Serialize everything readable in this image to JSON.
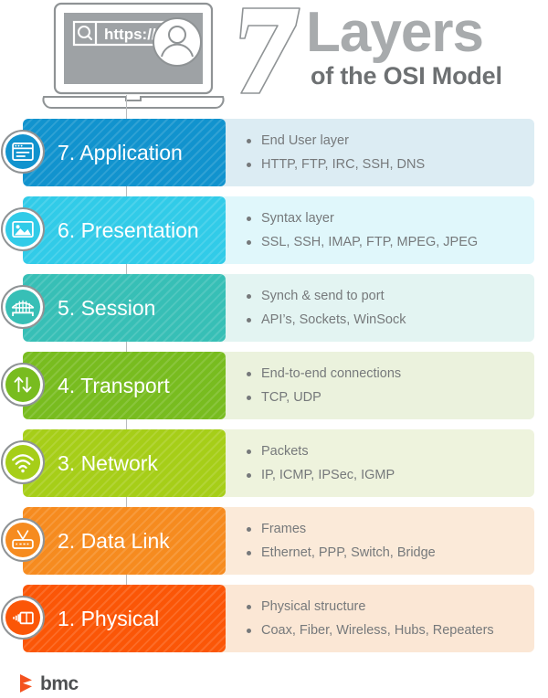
{
  "header": {
    "title_number": "7",
    "title_main": "Layers",
    "title_sub": "of the OSI Model",
    "laptop": {
      "search_icon": "search-icon",
      "url_text": "https://",
      "avatar_icon": "user-avatar-icon"
    }
  },
  "colors": {
    "layer7_bar": "#1193ce",
    "layer7_panel": "#dcecf3",
    "layer6_bar": "#31cbe8",
    "layer6_panel": "#e0f7fb",
    "layer5_bar": "#37bfb6",
    "layer5_panel": "#e3f4f2",
    "layer4_bar": "#78bc1f",
    "layer4_panel": "#ebf2dd",
    "layer3_bar": "#a6ce18",
    "layer3_panel": "#eef3dd",
    "layer2_bar": "#f68b1f",
    "layer2_panel": "#fbead9",
    "layer1_bar": "#fb5607",
    "layer1_panel": "#fbe7d5",
    "bullet_text": "#76797b",
    "title_main": "#a8abad",
    "title_sub": "#6d7072",
    "logo_orange": "#f4511e",
    "logo_text": "#4e5052"
  },
  "layers": [
    {
      "number": "7.",
      "name": "Application",
      "label": "7. Application",
      "icon": "browser-window-icon",
      "bullets": [
        "End User layer",
        "HTTP, FTP, IRC, SSH, DNS"
      ]
    },
    {
      "number": "6.",
      "name": "Presentation",
      "label": "6. Presentation",
      "icon": "image-picture-icon",
      "bullets": [
        "Syntax layer",
        "SSL, SSH, IMAP, FTP, MPEG, JPEG"
      ]
    },
    {
      "number": "5.",
      "name": "Session",
      "label": "5. Session",
      "icon": "bridge-icon",
      "bullets": [
        "Synch & send to port",
        "API’s, Sockets, WinSock"
      ]
    },
    {
      "number": "4.",
      "name": "Transport",
      "label": "4. Transport",
      "icon": "up-down-arrows-icon",
      "bullets": [
        "End-to-end connections",
        "TCP, UDP"
      ]
    },
    {
      "number": "3.",
      "name": "Network",
      "label": "3. Network",
      "icon": "wifi-signal-icon",
      "bullets": [
        "Packets",
        "IP, ICMP, IPSec, IGMP"
      ]
    },
    {
      "number": "2.",
      "name": "Data Link",
      "label": "2. Data Link",
      "icon": "router-icon",
      "bullets": [
        "Frames",
        "Ethernet, PPP, Switch, Bridge"
      ]
    },
    {
      "number": "1.",
      "name": "Physical",
      "label": "1. Physical",
      "icon": "cable-connector-icon",
      "bullets": [
        "Physical structure",
        "Coax, Fiber, Wireless, Hubs, Repeaters"
      ]
    }
  ],
  "footer": {
    "logo_text": "bmc",
    "logo_mark": "bmc-chevron-icon"
  }
}
